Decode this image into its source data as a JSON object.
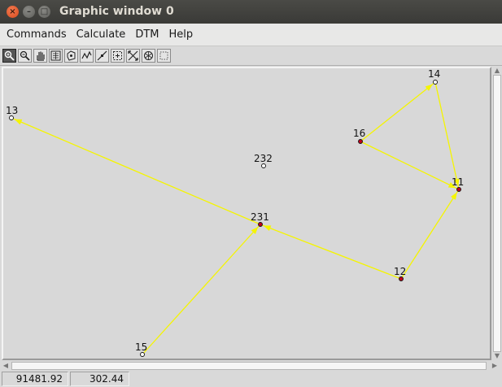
{
  "window": {
    "title": "Graphic window 0",
    "close_glyph": "×",
    "min_glyph": "–",
    "max_glyph": "□"
  },
  "menu": [
    "Commands",
    "Calculate",
    "DTM",
    "Help"
  ],
  "toolbar": {
    "tools": [
      "zoom-window-icon",
      "zoom-out-icon",
      "pan-hand-icon",
      "zoom-extents-icon",
      "redraw-icon",
      "draw-line-icon",
      "select-line-icon",
      "dashed-select-icon",
      "cross-select-icon",
      "network-icon",
      "blank-tool-icon"
    ]
  },
  "canvas": {
    "colors": {
      "background": "#d8d8d8",
      "line": "#f5f500",
      "red_point": "#c0001a",
      "white_point": "#ffffff"
    },
    "points": [
      {
        "id": "13",
        "label": "13",
        "fill": "white"
      },
      {
        "id": "14",
        "label": "14",
        "fill": "white"
      },
      {
        "id": "16",
        "label": "16",
        "fill": "red"
      },
      {
        "id": "232",
        "label": "232",
        "fill": "white"
      },
      {
        "id": "11",
        "label": "11",
        "fill": "red"
      },
      {
        "id": "231",
        "label": "231",
        "fill": "red"
      },
      {
        "id": "12",
        "label": "12",
        "fill": "red"
      },
      {
        "id": "15",
        "label": "15",
        "fill": "white"
      }
    ],
    "lines": [
      [
        "231",
        "13"
      ],
      [
        "16",
        "14"
      ],
      [
        "16",
        "11"
      ],
      [
        "14",
        "11"
      ],
      [
        "12",
        "11"
      ],
      [
        "12",
        "231"
      ],
      [
        "15",
        "231"
      ]
    ]
  },
  "status": {
    "x_value": "91481.92",
    "y_value": "302.44"
  }
}
